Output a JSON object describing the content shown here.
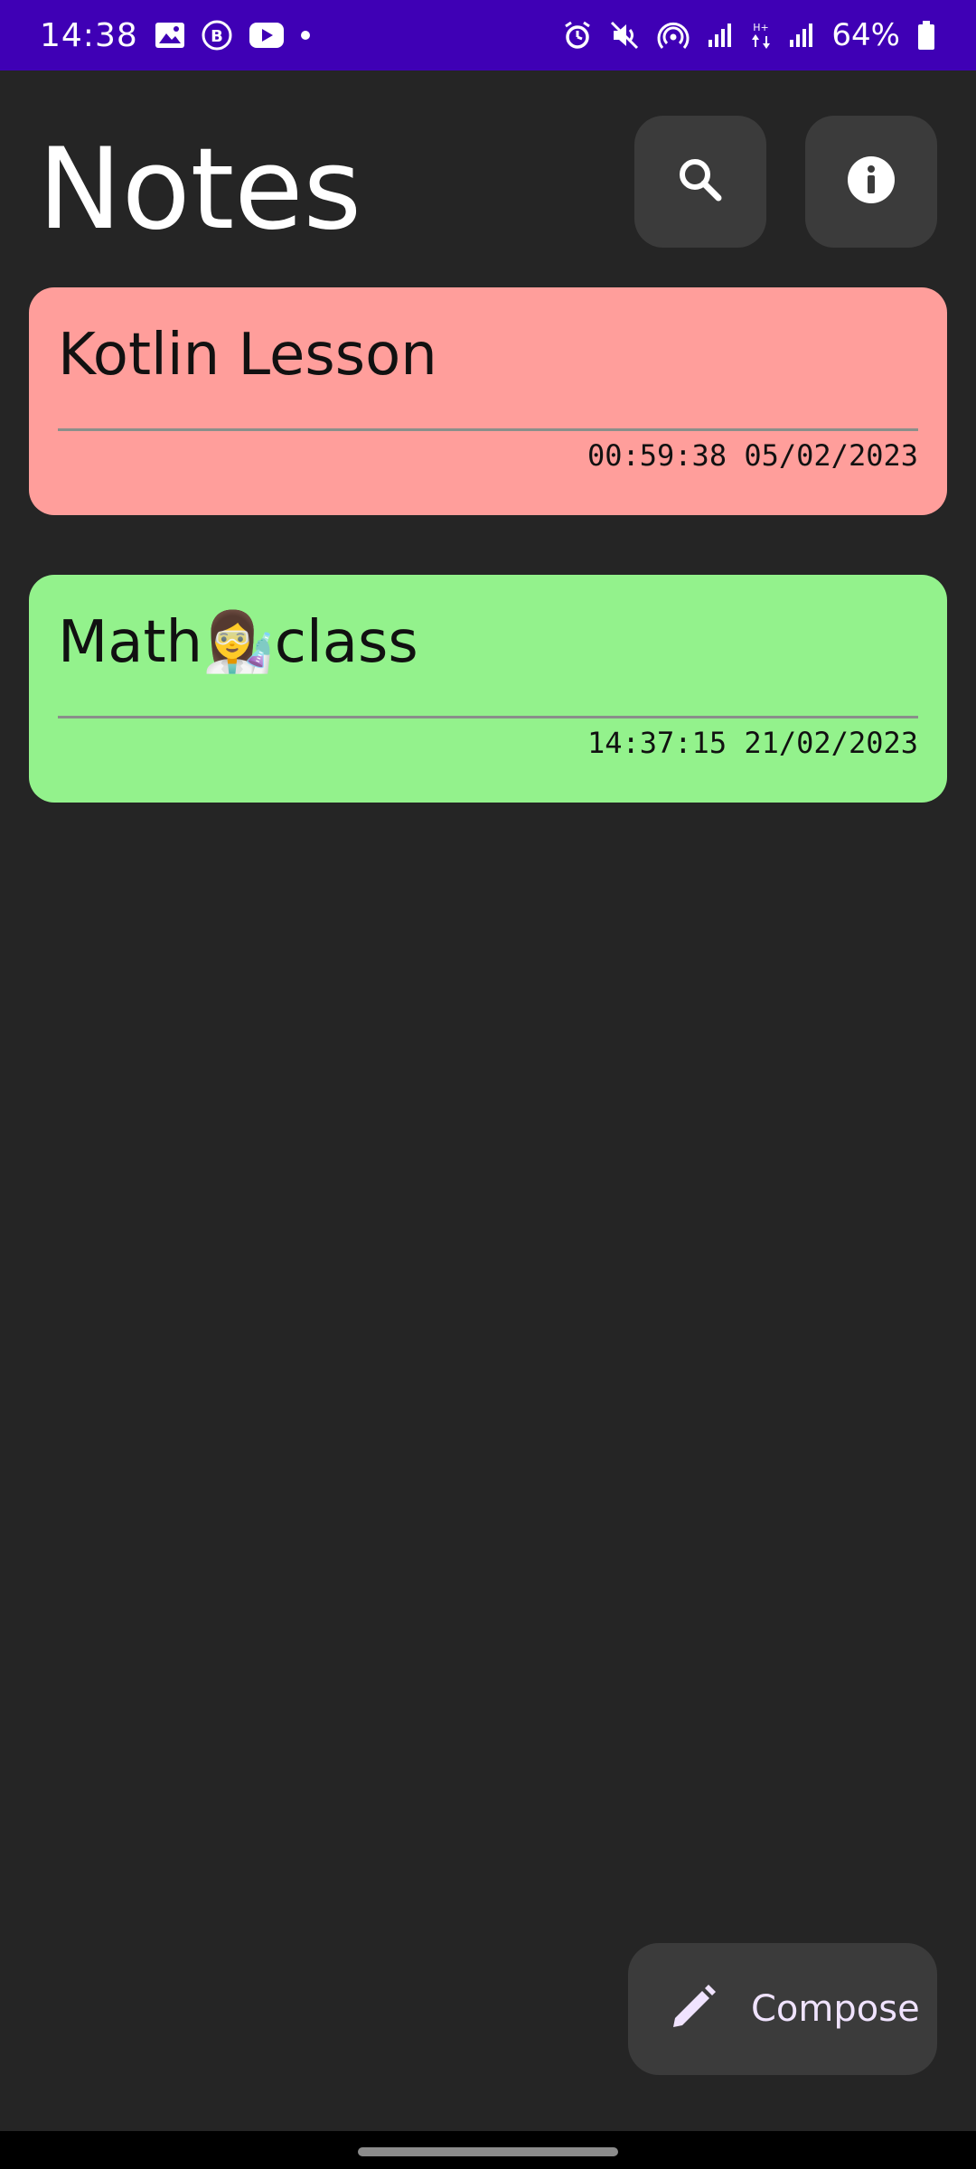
{
  "status_bar": {
    "time": "14:38",
    "battery_percent": "64%",
    "icons": [
      "image-icon",
      "b-icon",
      "youtube-icon",
      "dot-icon",
      "alarm-icon",
      "mute-icon",
      "hotspot-icon",
      "signal-icon",
      "data-arrows-icon",
      "signal-icon-2",
      "battery-icon"
    ],
    "bar_color": "#3f00b5"
  },
  "header": {
    "title": "Notes"
  },
  "notes": [
    {
      "title": "Kotlin Lesson",
      "timestamp": "00:59:38 05/02/2023",
      "color": "#ff9e9b"
    },
    {
      "title": "Math👩‍🔬class",
      "timestamp": "14:37:15 21/02/2023",
      "color": "#93f28c"
    }
  ],
  "fab": {
    "label": "Compose",
    "icon": "pencil-icon"
  },
  "colors": {
    "background": "#252525",
    "button_bg": "#3b3b3b"
  }
}
